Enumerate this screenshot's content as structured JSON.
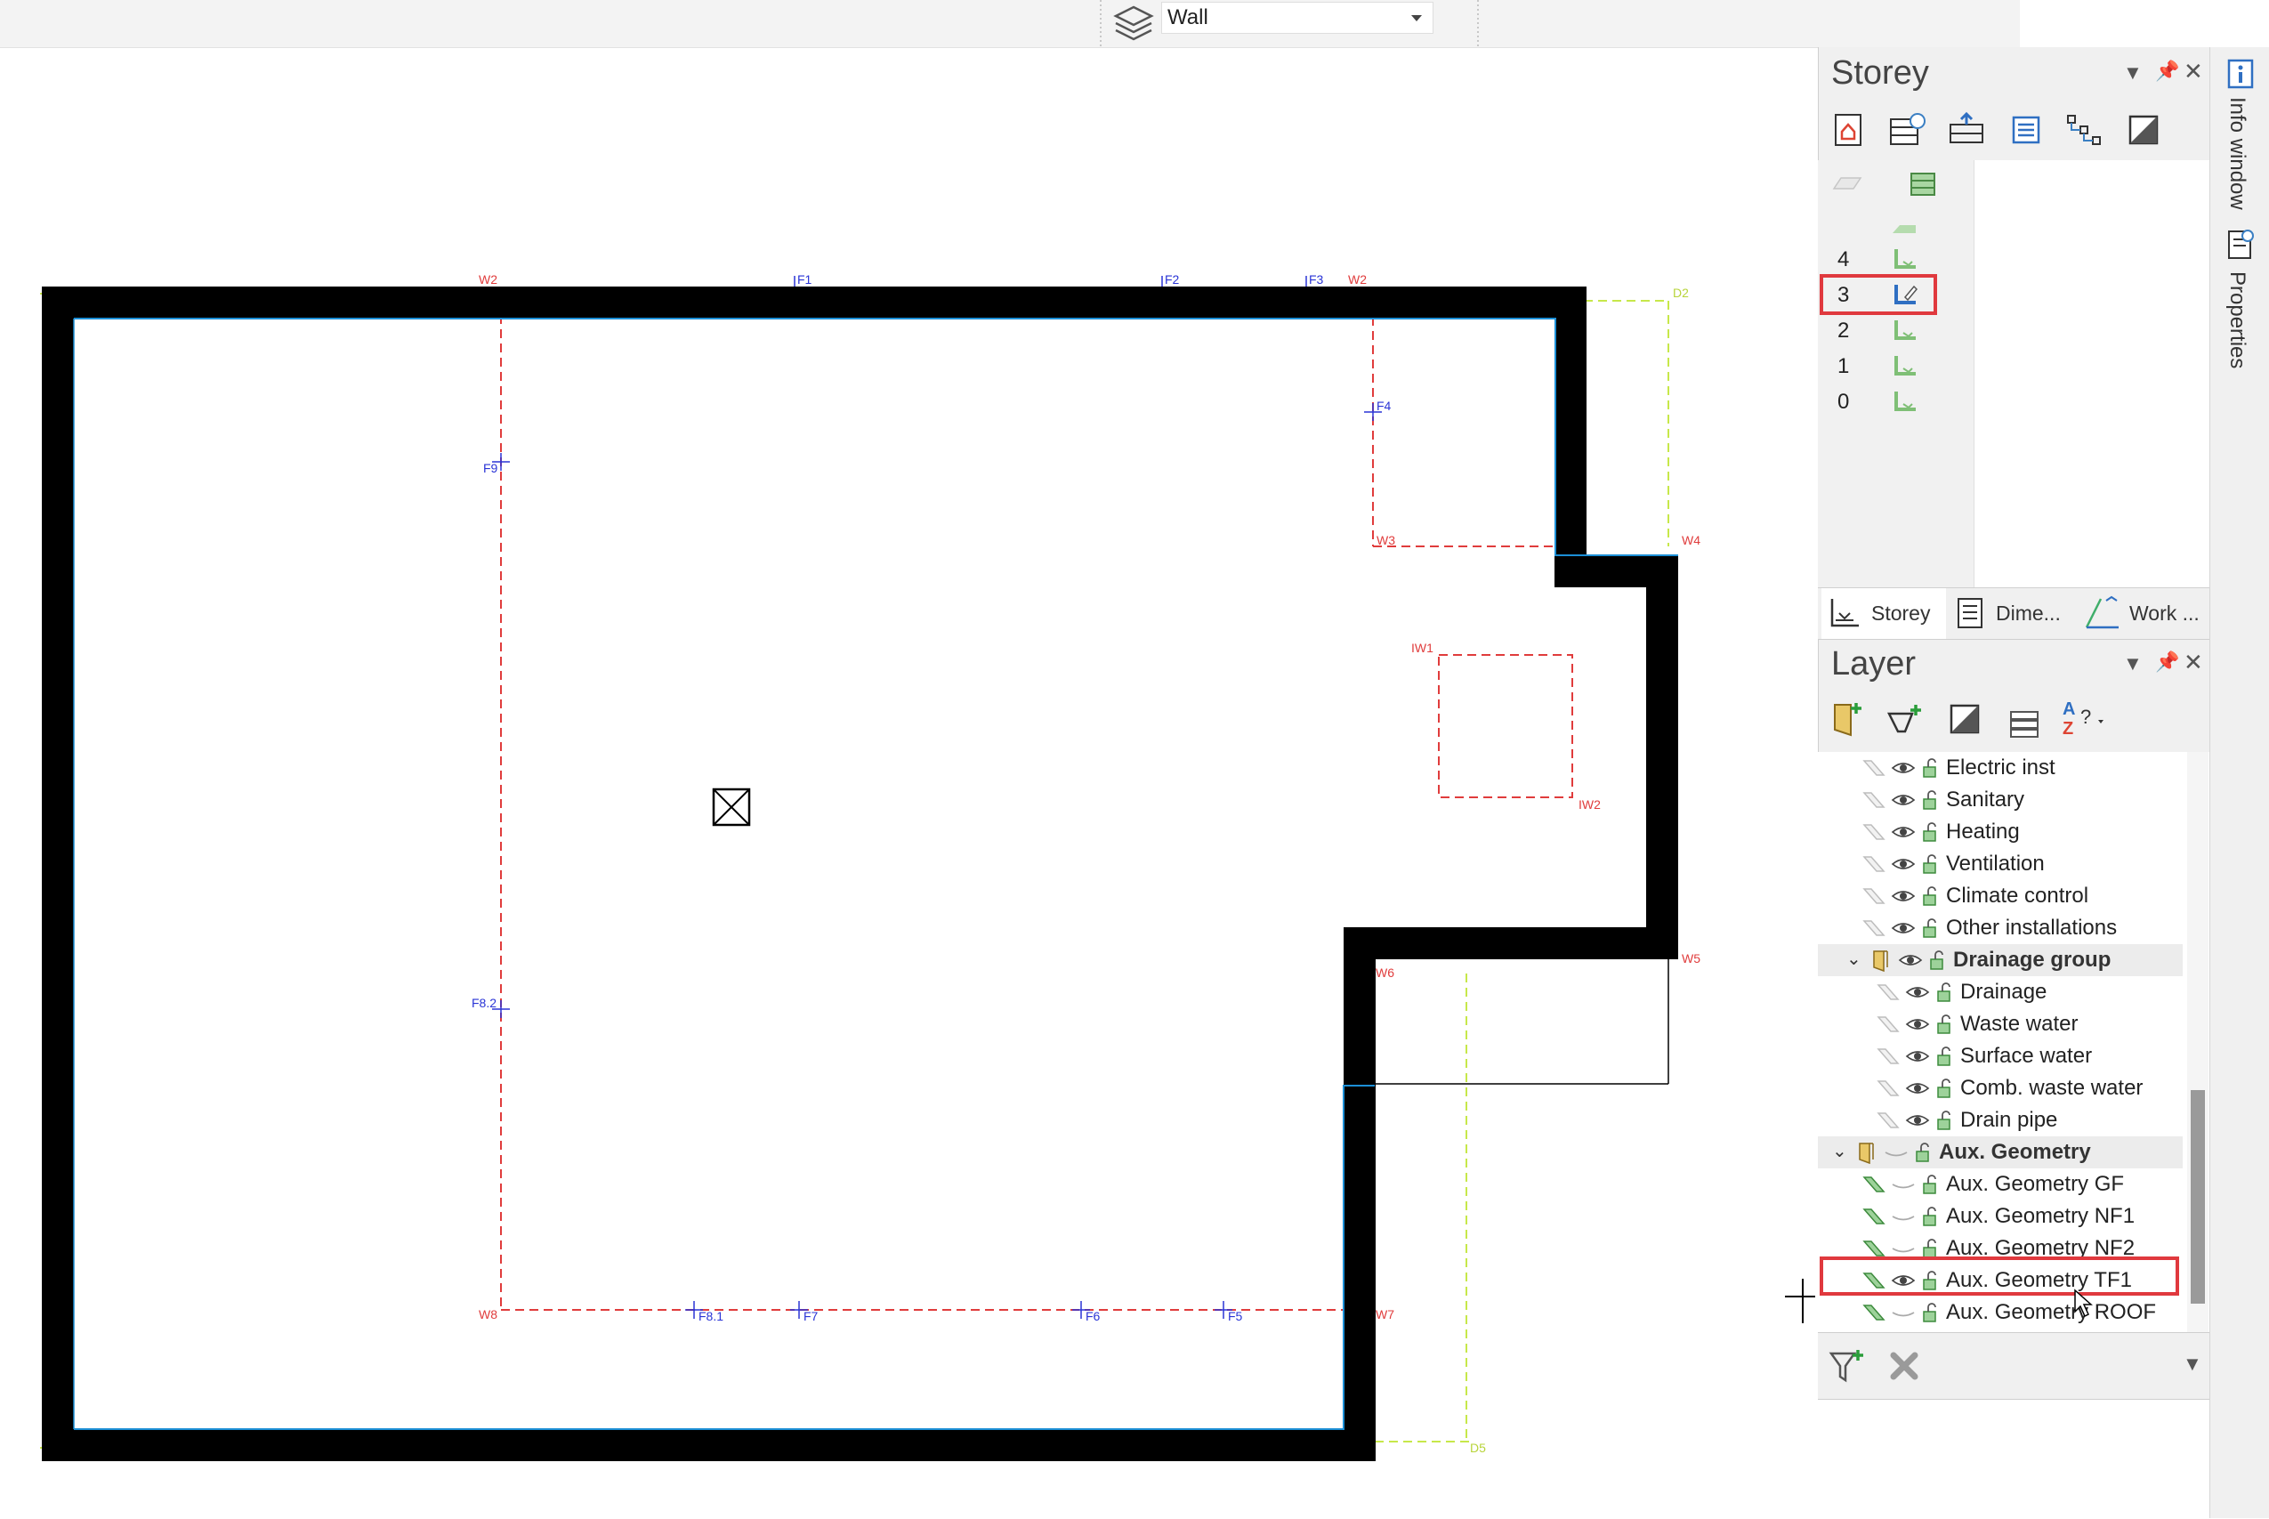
{
  "toolbar": {
    "layer_combo_value": "Wall"
  },
  "drawing": {
    "grid_labels_red": [
      "W2",
      "W2",
      "W3",
      "W4",
      "IW1",
      "IW2",
      "W5",
      "W6",
      "W7",
      "W8"
    ],
    "grid_labels_blue": [
      "F1",
      "F2",
      "F3",
      "F4",
      "F9",
      "F8.2",
      "F8.1",
      "F7",
      "F6",
      "F5"
    ],
    "grid_labels_green": [
      "D2",
      "D5"
    ]
  },
  "storey_panel": {
    "title": "Storey",
    "storeys": [
      "4",
      "3",
      "2",
      "1",
      "0"
    ],
    "selected_storey": "3",
    "tabs": [
      "Storey",
      "Dime...",
      "Work ..."
    ]
  },
  "layer_panel": {
    "title": "Layer",
    "sort_label": "A Z ?",
    "rows": [
      {
        "label": "Electric inst",
        "group": false
      },
      {
        "label": "Sanitary",
        "group": false
      },
      {
        "label": "Heating",
        "group": false
      },
      {
        "label": "Ventilation",
        "group": false
      },
      {
        "label": "Climate control",
        "group": false
      },
      {
        "label": "Other installations",
        "group": false
      },
      {
        "label": "Drainage group",
        "group": true
      },
      {
        "label": "Drainage",
        "group": false
      },
      {
        "label": "Waste water",
        "group": false
      },
      {
        "label": "Surface water",
        "group": false
      },
      {
        "label": "Comb. waste water",
        "group": false
      },
      {
        "label": "Drain pipe",
        "group": false
      },
      {
        "label": "Aux. Geometry",
        "group": true
      },
      {
        "label": "Aux. Geometry GF",
        "group": false
      },
      {
        "label": "Aux. Geometry NF1",
        "group": false
      },
      {
        "label": "Aux. Geometry NF2",
        "group": false
      },
      {
        "label": "Aux. Geometry TF1",
        "group": false,
        "highlighted": true
      },
      {
        "label": "Aux. Geometry ROOF",
        "group": false
      }
    ]
  },
  "sidebar": {
    "info_window": "Info window",
    "properties": "Properties"
  },
  "colors": {
    "highlight": "#e0393e",
    "grid_red": "#e03c3c",
    "grid_blue": "#2a34d6",
    "grid_green": "#c7e84a",
    "wall": "#000000"
  }
}
